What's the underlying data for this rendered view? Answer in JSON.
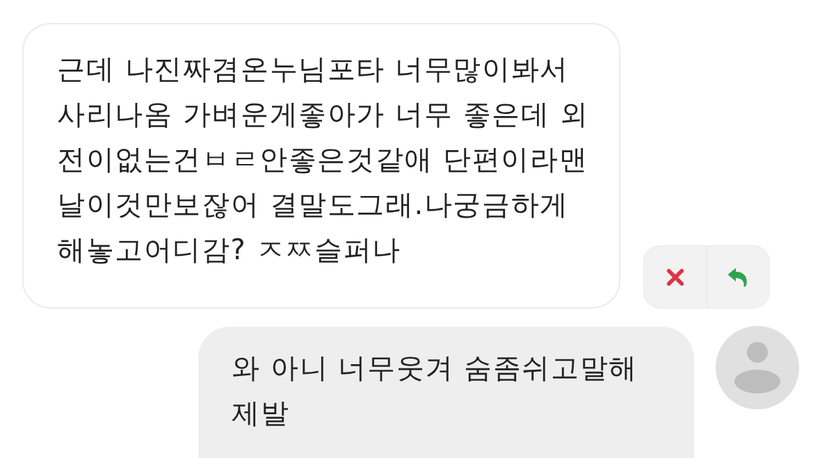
{
  "messages": [
    {
      "kind": "received",
      "text": "근데 나진짜겸온누님포타 너무많이봐서 사리나옴 가벼운게좋아가 너무 좋은데 외전이없는건ㅂㄹ안좋은것같애 단편이라맨날이것만보잖어 결말도그래.나궁금하게 해놓고어디감? ㅈㅉ슬퍼나"
    },
    {
      "kind": "sent",
      "text": "와 아니 너무웃겨 숨좀쉬고말해 제발"
    }
  ]
}
